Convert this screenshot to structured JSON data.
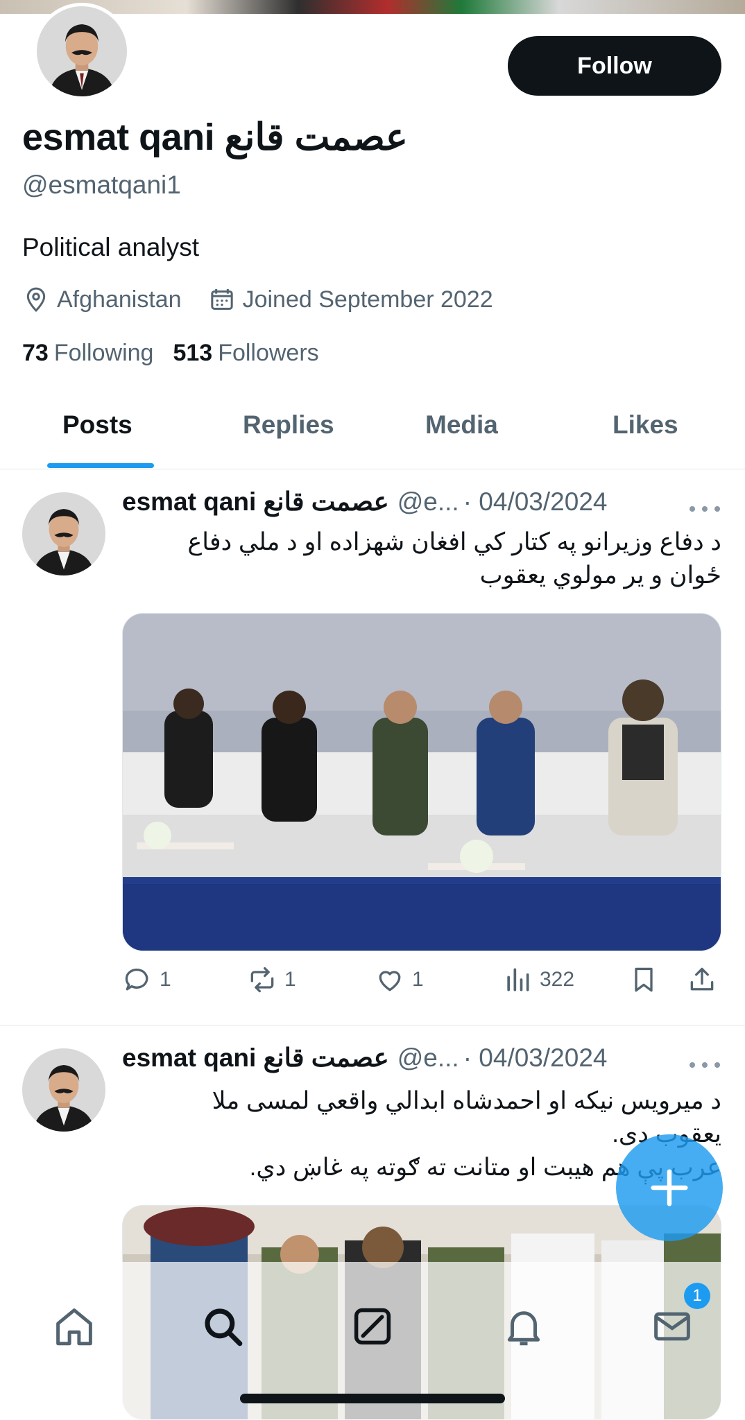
{
  "profile": {
    "display_name": "esmat qani عصمت قانع",
    "handle": "@esmatqani1",
    "bio": "Political analyst",
    "location": "Afghanistan",
    "joined": "Joined September 2022",
    "following_count": "73",
    "following_label": "Following",
    "followers_count": "513",
    "followers_label": "Followers",
    "follow_label": "Follow"
  },
  "tabs": [
    {
      "label": "Posts",
      "active": true
    },
    {
      "label": "Replies",
      "active": false
    },
    {
      "label": "Media",
      "active": false
    },
    {
      "label": "Likes",
      "active": false
    }
  ],
  "posts": [
    {
      "author": "esmat qani عصمت قانع",
      "handle": "@e...",
      "date": "· 04/03/2024",
      "text_lines": [
        "د دفاع وزيرانو په کتار کي افغان شهزاده او د ملي دفاع",
        "ځوان و ير مولوي يعقوب"
      ],
      "replies": "1",
      "reposts": "1",
      "likes": "1",
      "views": "322"
    },
    {
      "author": "esmat qani عصمت قانع",
      "handle": "@e...",
      "date": "· 04/03/2024",
      "text_lines": [
        "د ميرويس نيکه او احمدشاه ابدالي واقعي لمسی ملا",
        "يعقوب دی.",
        "عرب پې هم هيبت او متانت ته ګوته په غاښ دي."
      ]
    }
  ],
  "nav": {
    "messages_badge": "1",
    "icons": [
      "home-icon",
      "search-icon",
      "grok-icon",
      "bell-icon",
      "mail-icon"
    ]
  },
  "colors": {
    "accent": "#1d9bf0",
    "text": "#0f1419",
    "muted": "#536471"
  }
}
